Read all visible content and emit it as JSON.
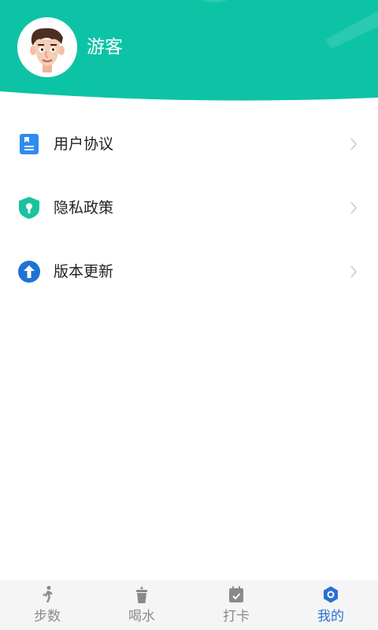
{
  "colors": {
    "header_bg": "#0dc3a6",
    "accent_blue": "#2b6fd6",
    "agreement_icon": "#2d8cf0",
    "privacy_icon": "#19c29f",
    "update_icon": "#1f73d6",
    "nav_inactive": "#8a8a8a"
  },
  "profile": {
    "username": "游客"
  },
  "menu": {
    "items": [
      {
        "label": "用户协议",
        "icon": "document-icon"
      },
      {
        "label": "隐私政策",
        "icon": "shield-lock-icon"
      },
      {
        "label": "版本更新",
        "icon": "arrow-up-circle-icon"
      }
    ]
  },
  "bottom_nav": {
    "tabs": [
      {
        "label": "步数",
        "icon": "walking-icon",
        "active": false
      },
      {
        "label": "喝水",
        "icon": "cup-icon",
        "active": false
      },
      {
        "label": "打卡",
        "icon": "calendar-check-icon",
        "active": false
      },
      {
        "label": "我的",
        "icon": "hexagon-icon",
        "active": true
      }
    ]
  }
}
